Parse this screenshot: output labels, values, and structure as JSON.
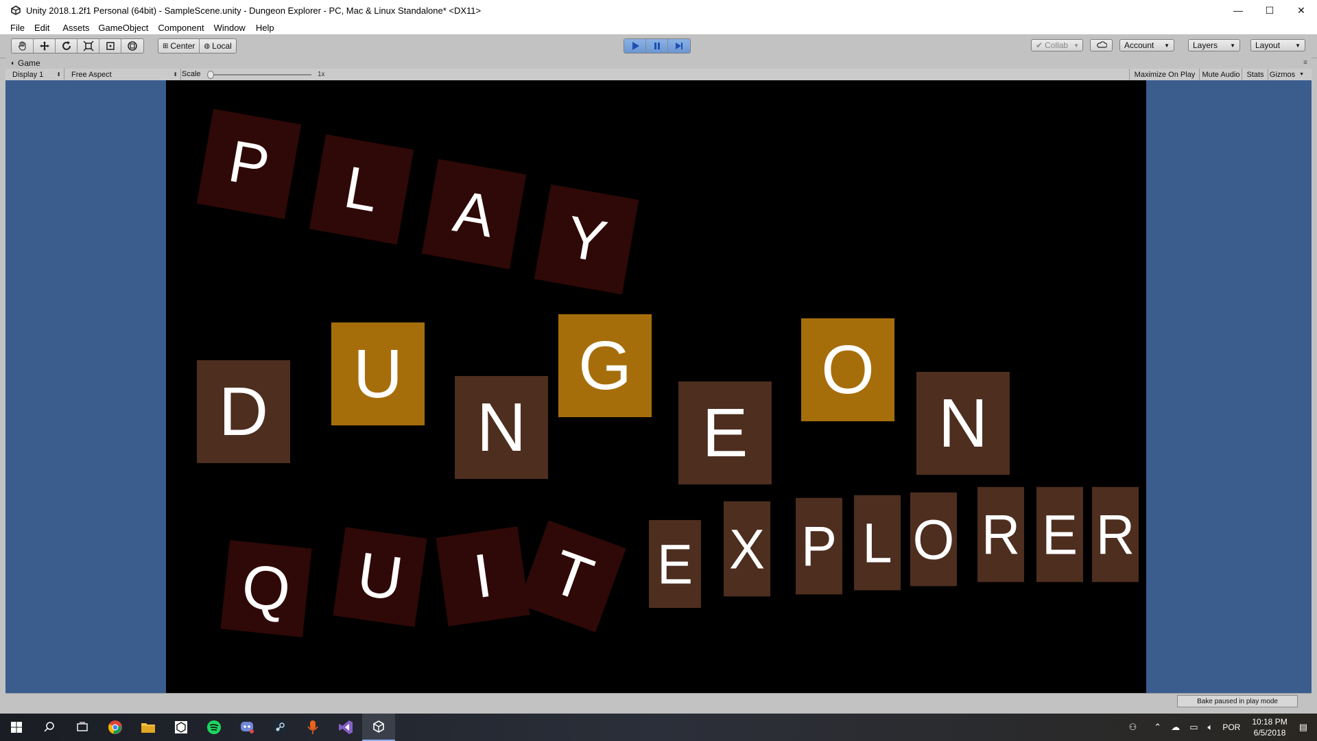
{
  "window": {
    "title": "Unity 2018.1.2f1 Personal (64bit) - SampleScene.unity - Dungeon Explorer - PC, Mac & Linux Standalone* <DX11>",
    "controls": [
      "—",
      "☐",
      "✕"
    ]
  },
  "menu": [
    "File",
    "Edit",
    "Assets",
    "GameObject",
    "Component",
    "Window",
    "Help"
  ],
  "toolbar": {
    "pivot_center": "Center",
    "pivot_local": "Local",
    "collab": "Collab",
    "account": "Account",
    "layers": "Layers",
    "layout": "Layout",
    "play_state": "playing"
  },
  "game_panel": {
    "tab_label": "Game",
    "display": "Display 1",
    "aspect": "Free Aspect",
    "scale_label": "Scale",
    "scale_value": "1x",
    "maximize_on_play": "Maximize On Play",
    "mute_audio": "Mute Audio",
    "stats": "Stats",
    "gizmos": "Gizmos"
  },
  "game_scene": {
    "colors": {
      "dark": "#2f0907",
      "brown": "#4d2e1f",
      "gold": "#a66e0b",
      "background": "#000000",
      "letter": "#ffffff"
    },
    "play_letters": [
      "P",
      "L",
      "A",
      "Y"
    ],
    "dungeon_letters": [
      "D",
      "U",
      "N",
      "G",
      "E",
      "O",
      "N"
    ],
    "quit_letters": [
      "Q",
      "U",
      "I",
      "T"
    ],
    "explorer_letters": [
      "E",
      "X",
      "P",
      "L",
      "O",
      "R",
      "E",
      "R"
    ]
  },
  "status": {
    "bake": "Bake paused in play mode"
  },
  "taskbar": {
    "language": "POR",
    "time": "10:18 PM",
    "date": "6/5/2018"
  }
}
